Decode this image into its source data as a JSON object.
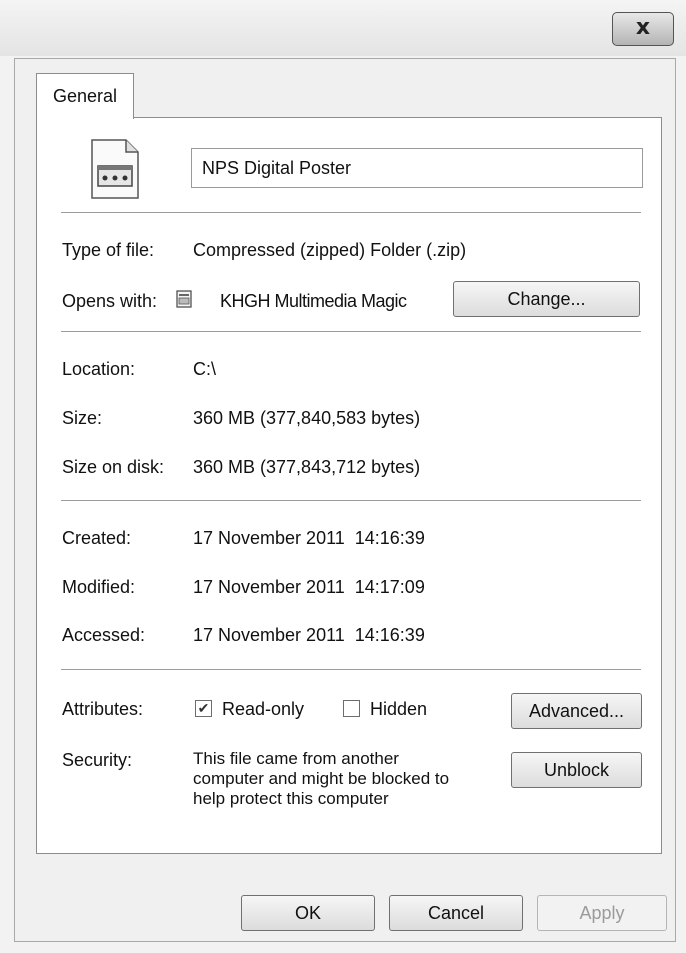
{
  "window": {
    "close_label": "x"
  },
  "tabs": [
    {
      "label": "General"
    }
  ],
  "file": {
    "name": "NPS Digital Poster",
    "icon": "zip-folder-icon"
  },
  "fields": {
    "type_label": "Type of file:",
    "type_value": "Compressed (zipped) Folder (.zip)",
    "opens_label": "Opens with:",
    "opens_value": "KHGH Multimedia Magic",
    "opens_icon": "application-icon",
    "change_label": "Change...",
    "location_label": "Location:",
    "location_value": "C:\\",
    "size_label": "Size:",
    "size_value": "360 MB (377,840,583 bytes)",
    "disk_label": "Size on disk:",
    "disk_value": "360 MB (377,843,712 bytes)",
    "created_label": "Created:",
    "created_value": "17 November 2011  14:16:39",
    "modified_label": "Modified:",
    "modified_value": "17 November 2011  14:17:09",
    "accessed_label": "Accessed:",
    "accessed_value": "17 November 2011  14:16:39"
  },
  "attributes": {
    "label": "Attributes:",
    "readonly_label": "Read-only",
    "readonly_checked": true,
    "hidden_label": "Hidden",
    "hidden_checked": false,
    "advanced_label": "Advanced..."
  },
  "security": {
    "label": "Security:",
    "text_lines": [
      "This file came from another",
      "computer and might be blocked to",
      "help protect this computer"
    ],
    "unblock_label": "Unblock"
  },
  "buttons": {
    "ok": "OK",
    "cancel": "Cancel",
    "apply": "Apply"
  }
}
